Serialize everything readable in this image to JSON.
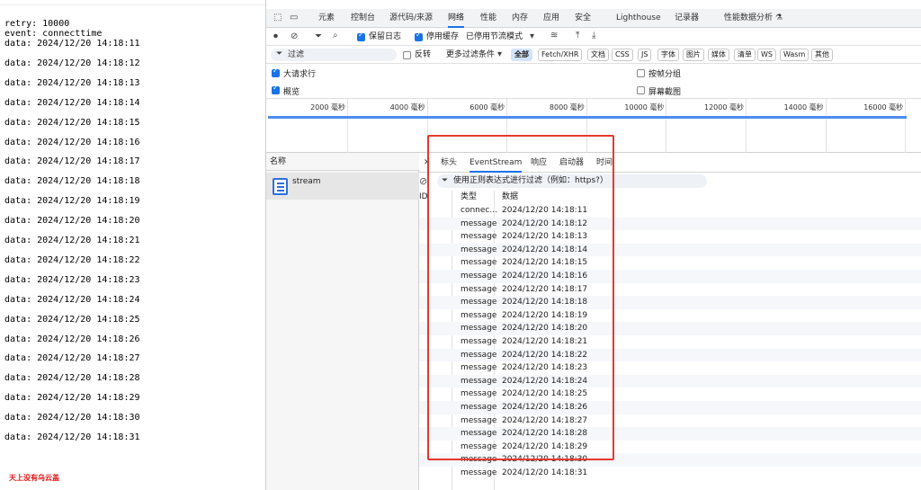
{
  "left": {
    "retry_line": "retry: 10000",
    "event_line": "event: connecttime",
    "data_lines": [
      "data: 2024/12/20 14:18:11",
      "data: 2024/12/20 14:18:12",
      "data: 2024/12/20 14:18:13",
      "data: 2024/12/20 14:18:14",
      "data: 2024/12/20 14:18:15",
      "data: 2024/12/20 14:18:16",
      "data: 2024/12/20 14:18:17",
      "data: 2024/12/20 14:18:18",
      "data: 2024/12/20 14:18:19",
      "data: 2024/12/20 14:18:20",
      "data: 2024/12/20 14:18:21",
      "data: 2024/12/20 14:18:22",
      "data: 2024/12/20 14:18:23",
      "data: 2024/12/20 14:18:24",
      "data: 2024/12/20 14:18:25",
      "data: 2024/12/20 14:18:26",
      "data: 2024/12/20 14:18:27",
      "data: 2024/12/20 14:18:28",
      "data: 2024/12/20 14:18:29",
      "data: 2024/12/20 14:18:30",
      "data: 2024/12/20 14:18:31"
    ],
    "watermark": "天上没有乌云盖"
  },
  "devtools": {
    "tabs": [
      "元素",
      "控制台",
      "源代码/来源",
      "网络",
      "性能",
      "内存",
      "应用",
      "安全",
      "Lighthouse",
      "记录器",
      "性能数据分析 ⚗"
    ],
    "active_tab": "网络",
    "toolbar": {
      "preserve_log": "保留日志",
      "disable_cache": "停用缓存",
      "throttling": "已停用节流模式"
    },
    "filter": {
      "placeholder": "过滤",
      "invert": "反转",
      "more_filters": "更多过滤条件",
      "chips": [
        "全部",
        "Fetch/XHR",
        "文档",
        "CSS",
        "JS",
        "字体",
        "图片",
        "媒体",
        "清单",
        "WS",
        "Wasm",
        "其他"
      ],
      "active_chip": "全部"
    },
    "options": {
      "large_rows": "大请求行",
      "group_by_frame": "按帧分组",
      "overview": "概览",
      "screenshots": "屏幕截图"
    },
    "timeline_ticks": [
      "2000 毫秒",
      "4000 毫秒",
      "6000 毫秒",
      "8000 毫秒",
      "10000 毫秒",
      "12000 毫秒",
      "14000 毫秒",
      "16000 毫秒"
    ],
    "requests": {
      "header": "名称",
      "items": [
        "stream"
      ]
    },
    "detail": {
      "tabs": [
        "标头",
        "EventStream",
        "响应",
        "启动器",
        "时间"
      ],
      "active_tab": "EventStream",
      "filter_placeholder": "使用正则表达式进行过滤（例如：https?）",
      "columns": [
        "ID",
        "类型",
        "数据"
      ],
      "events": [
        {
          "type": "connec...",
          "data": "2024/12/20 14:18:11"
        },
        {
          "type": "message",
          "data": "2024/12/20 14:18:12"
        },
        {
          "type": "message",
          "data": "2024/12/20 14:18:13"
        },
        {
          "type": "message",
          "data": "2024/12/20 14:18:14"
        },
        {
          "type": "message",
          "data": "2024/12/20 14:18:15"
        },
        {
          "type": "message",
          "data": "2024/12/20 14:18:16"
        },
        {
          "type": "message",
          "data": "2024/12/20 14:18:17"
        },
        {
          "type": "message",
          "data": "2024/12/20 14:18:18"
        },
        {
          "type": "message",
          "data": "2024/12/20 14:18:19"
        },
        {
          "type": "message",
          "data": "2024/12/20 14:18:20"
        },
        {
          "type": "message",
          "data": "2024/12/20 14:18:21"
        },
        {
          "type": "message",
          "data": "2024/12/20 14:18:22"
        },
        {
          "type": "message",
          "data": "2024/12/20 14:18:23"
        },
        {
          "type": "message",
          "data": "2024/12/20 14:18:24"
        },
        {
          "type": "message",
          "data": "2024/12/20 14:18:25"
        },
        {
          "type": "message",
          "data": "2024/12/20 14:18:26"
        },
        {
          "type": "message",
          "data": "2024/12/20 14:18:27"
        },
        {
          "type": "message",
          "data": "2024/12/20 14:18:28"
        },
        {
          "type": "message",
          "data": "2024/12/20 14:18:29"
        },
        {
          "type": "message",
          "data": "2024/12/20 14:18:30"
        },
        {
          "type": "message",
          "data": "2024/12/20 14:18:31"
        }
      ]
    }
  },
  "colors": {
    "accent": "#1a73e8",
    "highlight_box": "#e8382c",
    "watermark": "#dd1111"
  }
}
